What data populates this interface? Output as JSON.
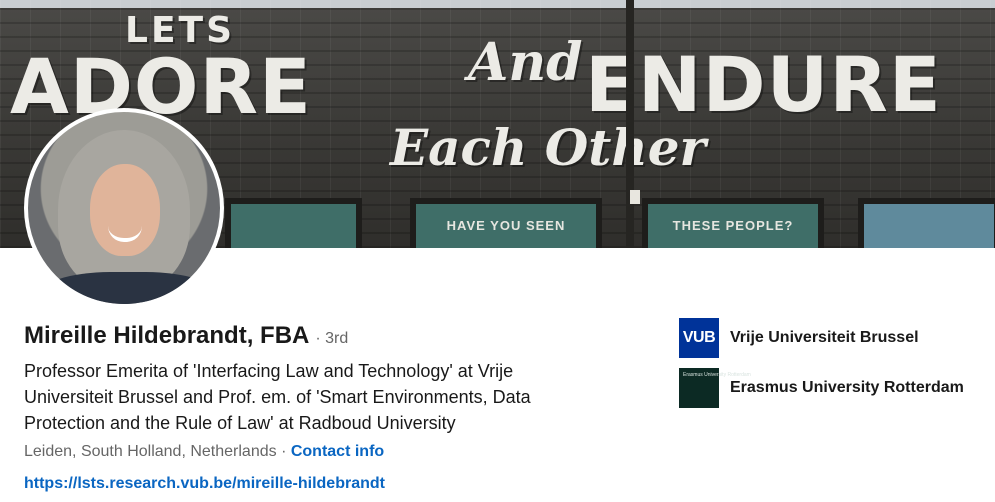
{
  "banner": {
    "mural": {
      "line1": "LETS",
      "line2a": "ADORE",
      "line2b": "And",
      "line2c": "ENDURE",
      "line3": "Each Other"
    },
    "windows": [
      "HAVE YOU SEEN",
      "THESE PEOPLE?"
    ]
  },
  "profile": {
    "name": "Mireille Hildebrandt, FBA",
    "degree": "· 3rd",
    "headline": "Professor Emerita of 'Interfacing Law and Technology' at Vrije Universiteit Brussel and Prof. em. of 'Smart Environments, Data Protection and the Rule of Law' at Radboud University",
    "location": "Leiden, South Holland, Netherlands",
    "location_sep": " · ",
    "contact_label": "Contact info",
    "website": "https://lsts.research.vub.be/mireille-hildebrandt"
  },
  "organizations": [
    {
      "logo_text": "VUB",
      "name": "Vrije Universiteit Brussel",
      "logo_color": "#003399"
    },
    {
      "logo_text": "Erasmus University Rotterdam",
      "name": "Erasmus University Rotterdam",
      "logo_color": "#0c2a24"
    }
  ],
  "colors": {
    "link": "#0a66c2",
    "text": "#191919",
    "muted": "#666666"
  }
}
